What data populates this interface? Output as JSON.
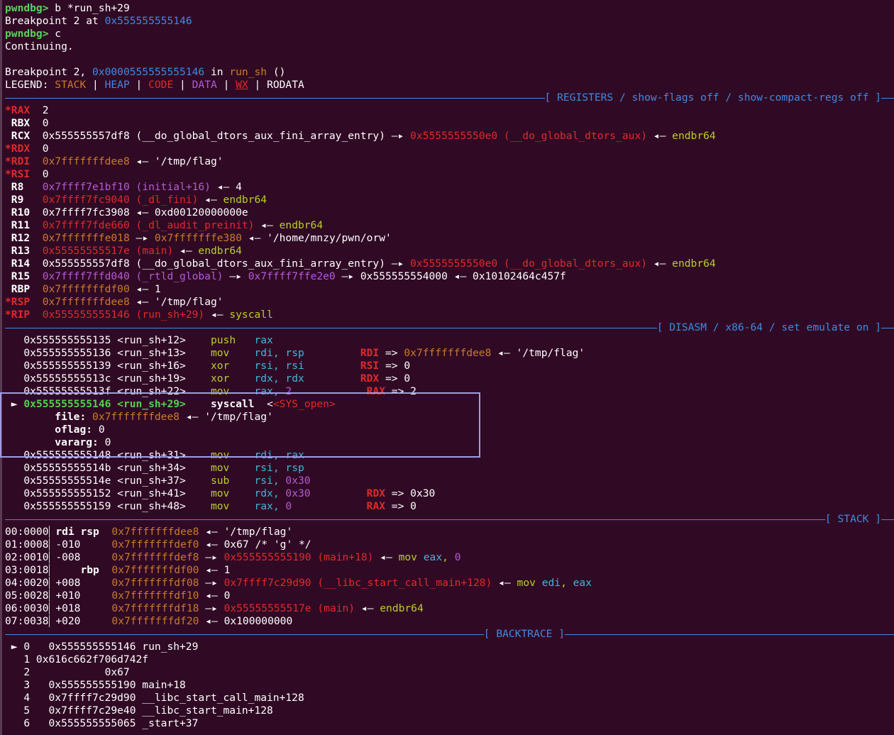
{
  "header": {
    "l1_prompt": "pwndbg>",
    "l1_cmd": " b *run_sh+29",
    "l2_text": "Breakpoint 2 at ",
    "l2_addr": "0x555555555146",
    "l3_prompt": "pwndbg>",
    "l3_cmd": " c",
    "l4": "Continuing.",
    "l6_a": "Breakpoint 2, ",
    "l6_addr": "0x0000555555555146",
    "l6_in": " in ",
    "l6_fn": "run_sh",
    "l6_tail": " ()",
    "legend": {
      "label": "LEGEND: ",
      "stack": "STACK",
      "sep": " | ",
      "heap": "HEAP",
      "code": "CODE",
      "data": "DATA",
      "wx": "WX",
      "rodata": "RODATA"
    }
  },
  "sections": {
    "registers": "[ REGISTERS / show-flags off / show-compact-regs off ]",
    "disasm": "[ DISASM / x86-64 / set emulate on ]",
    "stack": "[ STACK ]",
    "backtrace": "[ BACKTRACE ]"
  },
  "registers": {
    "rax": {
      "name": "*RAX",
      "val": "2"
    },
    "rbx": {
      "name": " RBX",
      "val": "0"
    },
    "rcx": {
      "name": " RCX",
      "a": "0x555555557df8 (__do_global_dtors_aux_fini_array_entry)",
      "arrow": " —▸ ",
      "b": "0x5555555550e0 (__do_global_dtors_aux)",
      "larrow": " ◂— ",
      "c": "endbr64"
    },
    "rdx": {
      "name": "*RDX",
      "val": "0"
    },
    "rdi": {
      "name": "*RDI",
      "a": "0x7fffffffdee8",
      "larrow": " ◂— ",
      "c": "'/tmp/flag'"
    },
    "rsi": {
      "name": "*RSI",
      "val": "0"
    },
    "r8": {
      "name": " R8 ",
      "a": "0x7ffff7e1bf10 (initial+16)",
      "larrow": " ◂— ",
      "c": "4"
    },
    "r9": {
      "name": " R9 ",
      "a": "0x7ffff7fc9040 (_dl_fini)",
      "larrow": " ◂— ",
      "c": "endbr64"
    },
    "r10": {
      "name": " R10",
      "a": "0x7ffff7fc3908",
      "larrow": " ◂— ",
      "c": "0xd00120000000e"
    },
    "r11": {
      "name": " R11",
      "a": "0x7ffff7fde660 (_dl_audit_preinit)",
      "larrow": " ◂— ",
      "c": "endbr64"
    },
    "r12": {
      "name": " R12",
      "a": "0x7fffffffe018",
      "arrow": " —▸ ",
      "b": "0x7fffffffe380",
      "larrow": " ◂— ",
      "c": "'/home/mnzy/pwn/orw'"
    },
    "r13": {
      "name": " R13",
      "a": "0x55555555517e (main)",
      "larrow": " ◂— ",
      "c": "endbr64"
    },
    "r14": {
      "name": " R14",
      "a": "0x555555557df8 (__do_global_dtors_aux_fini_array_entry)",
      "arrow": " —▸ ",
      "b": "0x5555555550e0 (__do_global_dtors_aux)",
      "larrow": " ◂— ",
      "c": "endbr64"
    },
    "r15": {
      "name": " R15",
      "a": "0x7ffff7ffd040 (_rtld_global)",
      "arrow": " —▸ ",
      "b": "0x7ffff7ffe2e0",
      "arrow2": " —▸ ",
      "b2": "0x555555554000",
      "larrow": " ◂— ",
      "c": "0x10102464c457f"
    },
    "rbp": {
      "name": " RBP",
      "a": "0x7fffffffdf00",
      "larrow": " ◂— ",
      "c": "1"
    },
    "rsp": {
      "name": "*RSP",
      "a": "0x7fffffffdee8",
      "larrow": " ◂— ",
      "c": "'/tmp/flag'"
    },
    "rip": {
      "name": "*RIP",
      "a": "0x555555555146 (run_sh+29)",
      "larrow": " ◂— ",
      "c": "syscall"
    }
  },
  "disasm": [
    {
      "addr": "0x555555555135 <run_sh+12>",
      "op": "push",
      "args": "rax",
      "ann": ""
    },
    {
      "addr": "0x555555555136 <run_sh+13>",
      "op": "mov",
      "args": "rdi, rsp",
      "ann_reg": "RDI",
      "ann_eq": " => ",
      "ann_val": "0x7fffffffdee8",
      "ann_l": " ◂— ",
      "ann_c": "'/tmp/flag'"
    },
    {
      "addr": "0x555555555139 <run_sh+16>",
      "op": "xor",
      "args": "rsi, rsi",
      "ann_reg": "RSI",
      "ann_eq": " => ",
      "ann_val": "0"
    },
    {
      "addr": "0x55555555513c <run_sh+19>",
      "op": "xor",
      "args": "rdx, rdx",
      "ann_reg": "RDX",
      "ann_eq": " => ",
      "ann_val": "0"
    },
    {
      "addr": "0x55555555513f <run_sh+22>",
      "op": "mov",
      "args": "rax, ",
      "args2": "2",
      "ann_reg": "RAX",
      "ann_eq": " => ",
      "ann_val": "2"
    },
    {
      "cur": "►",
      "addr": "0x555555555146 <run_sh+29>",
      "op": "syscall",
      "sys": "<SYS_open>"
    },
    {
      "addr": "0x555555555148 <run_sh+31>",
      "op": "mov",
      "args": "rdi, rax"
    },
    {
      "addr": "0x55555555514b <run_sh+34>",
      "op": "mov",
      "args": "rsi, rsp"
    },
    {
      "addr": "0x55555555514e <run_sh+37>",
      "op": "sub",
      "args": "rsi, ",
      "args2": "0x30"
    },
    {
      "addr": "0x555555555152 <run_sh+41>",
      "op": "mov",
      "args": "rdx, ",
      "args2": "0x30",
      "ann_reg": "RDX",
      "ann_eq": " => ",
      "ann_val": "0x30"
    },
    {
      "addr": "0x555555555159 <run_sh+48>",
      "op": "mov",
      "args": "rax, ",
      "args2": "0",
      "ann_reg": "RAX",
      "ann_eq": " => ",
      "ann_val": "0"
    }
  ],
  "syscall_args": {
    "file_label": "file:",
    "file_addr": "0x7fffffffdee8",
    "file_l": " ◂— ",
    "file_val": "'/tmp/flag'",
    "oflag_label": "oflag:",
    "oflag_val": "0",
    "vararg_label": "vararg:",
    "vararg_val": "0"
  },
  "stack": [
    {
      "idx": "00:0000",
      "off": "",
      "regs": "rdi rsp",
      "addr": "0x7fffffffdee8",
      "l": " ◂— ",
      "val": "'/tmp/flag'"
    },
    {
      "idx": "01:0008",
      "off": "-010",
      "addr": "0x7fffffffdef0",
      "l": " ◂— ",
      "val": "0x67 /* 'g' */"
    },
    {
      "idx": "02:0010",
      "off": "-008",
      "addr": "0x7fffffffdef8",
      "arrow": " —▸ ",
      "tgt": "0x555555555190 (main+18)",
      "l": " ◂— ",
      "ins": "mov ",
      "r1": "eax",
      "comma": ", ",
      "r2": "0"
    },
    {
      "idx": "03:0018",
      "off": "",
      "regs": "rbp",
      "addr": "0x7fffffffdf00",
      "l": " ◂— ",
      "val": "1"
    },
    {
      "idx": "04:0020",
      "off": "+008",
      "addr": "0x7fffffffdf08",
      "arrow": " —▸ ",
      "tgt": "0x7ffff7c29d90 (__libc_start_call_main+128)",
      "l": " ◂— ",
      "ins": "mov ",
      "r1": "edi",
      "comma": ", ",
      "r2": "eax"
    },
    {
      "idx": "05:0028",
      "off": "+010",
      "addr": "0x7fffffffdf10",
      "l": " ◂— ",
      "val": "0"
    },
    {
      "idx": "06:0030",
      "off": "+018",
      "addr": "0x7fffffffdf18",
      "arrow": " —▸ ",
      "tgt": "0x55555555517e (main)",
      "l": " ◂— ",
      "val_y": "endbr64"
    },
    {
      "idx": "07:0038",
      "off": "+020",
      "addr": "0x7fffffffdf20",
      "l": " ◂— ",
      "val": "0x100000000"
    }
  ],
  "backtrace": [
    {
      "line": " ► 0   0x555555555146 run_sh+29"
    },
    {
      "line": "   1 0x616c662f706d742f"
    },
    {
      "line": "   2            0x67"
    },
    {
      "line": "   3   0x555555555190 main+18"
    },
    {
      "line": "   4   0x7ffff7c29d90 __libc_start_call_main+128"
    },
    {
      "line": "   5   0x7ffff7c29e40 __libc_start_main+128"
    },
    {
      "line": "   6   0x555555555065 _start+37"
    }
  ],
  "colors": {
    "background": "#300a24",
    "accent_blue": "#3f8ae2",
    "highlight_box": "#a09be8"
  }
}
